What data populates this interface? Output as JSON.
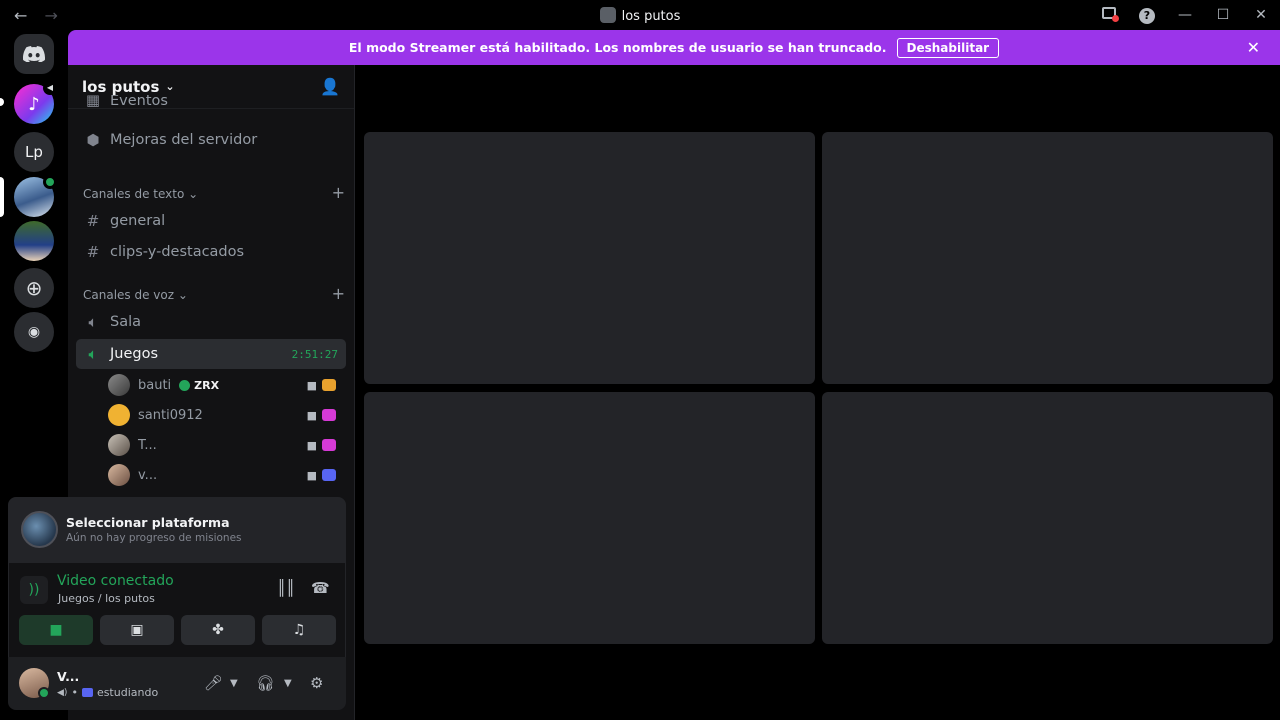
{
  "window": {
    "title": "los putos"
  },
  "banner": {
    "message": "El modo Streamer está habilitado. Los nombres de usuario se han truncado.",
    "button": "Deshabilitar"
  },
  "guilds": [
    {
      "id": "home",
      "label": ""
    },
    {
      "id": "tiktok",
      "label": ""
    },
    {
      "id": "lp",
      "label": "Lp"
    }
  ],
  "server": {
    "name": "los putos",
    "partial_item": "Eventos",
    "boost": "Mejoras del servidor",
    "text_category": "Canales de texto",
    "text_channels": [
      "general",
      "clips-y-destacados"
    ],
    "voice_category": "Canales de voz",
    "voice_channels": [
      "Sala",
      "Juegos"
    ],
    "active_timer": "2:51:27",
    "members": [
      {
        "name": "bauti",
        "tag": "ZRX"
      },
      {
        "name": "santi0912",
        "tag": ""
      },
      {
        "name": "T...",
        "tag": ""
      },
      {
        "name": "v...",
        "tag": ""
      }
    ]
  },
  "quest": {
    "title": "Seleccionar plataforma",
    "subtitle": "Aún no hay progreso de misiones"
  },
  "voice": {
    "status": "Video conectado",
    "location": "Juegos / los putos"
  },
  "user": {
    "name": "V...",
    "status": "estudiando"
  },
  "colors": {
    "accent_banner": "#9b35ea",
    "voice_green": "#23a55a",
    "background": "#000000",
    "panel": "#121214"
  }
}
